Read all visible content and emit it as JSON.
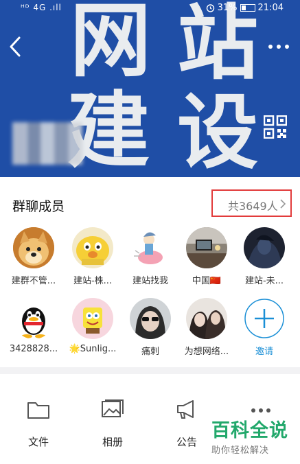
{
  "status_bar": {
    "signal": "ᴴᴰ 4G .ıll",
    "battery": "31%",
    "time": "21:04"
  },
  "banner": {
    "chars": [
      "网",
      "站",
      "建",
      "设"
    ]
  },
  "section": {
    "title": "群聊成员",
    "count": "共3649人"
  },
  "members": [
    {
      "name": "建群不管..."
    },
    {
      "name": "建站-株..."
    },
    {
      "name": "建站找我"
    },
    {
      "name": "中国🇨🇳"
    },
    {
      "name": "建站-未..."
    },
    {
      "name": "3428828..."
    },
    {
      "name": "🌟Sunlig..."
    },
    {
      "name": "痛刺"
    },
    {
      "name": "为想网络..."
    },
    {
      "name": "邀请"
    }
  ],
  "toolbar": {
    "files": "文件",
    "album": "相册",
    "notice": "公告"
  },
  "watermark": {
    "title": "百科全说",
    "subtitle": "助你轻松解决"
  },
  "colors": {
    "banner_bg": "#1f4ea6",
    "highlight_box": "#e23b3b",
    "accent_blue": "#1a8fd6",
    "watermark_green": "#22a86b"
  }
}
